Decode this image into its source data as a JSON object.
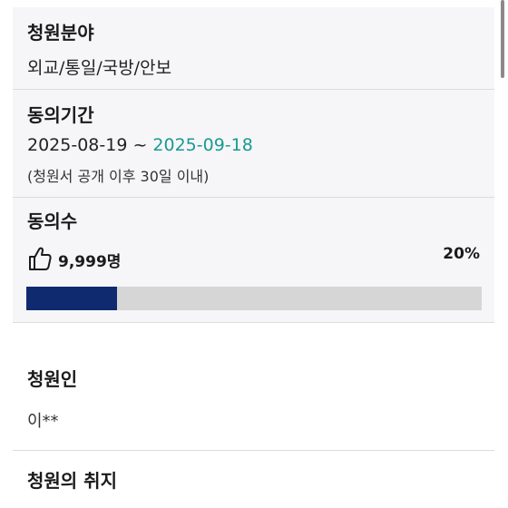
{
  "field": {
    "heading": "청원분야",
    "value": "외교/통일/국방/안보"
  },
  "period": {
    "heading": "동의기간",
    "start": "2025-08-19",
    "separator": " ~ ",
    "end": "2025-09-18",
    "note": "(청원서 공개 이후 30일 이내)"
  },
  "agree_count": {
    "heading": "동의수",
    "icon": "thumbs-up-icon",
    "count": "9,999명",
    "percent_label": "20%",
    "progress": 0.2
  },
  "petitioner": {
    "heading": "청원인",
    "value": "이**"
  },
  "purpose": {
    "heading": "청원의 취지"
  },
  "colors": {
    "accent_teal": "#1a9a8f",
    "progress_fill": "#0f2a6e",
    "progress_track": "#d6d6d6",
    "panel_bg": "#f6f6f8"
  }
}
